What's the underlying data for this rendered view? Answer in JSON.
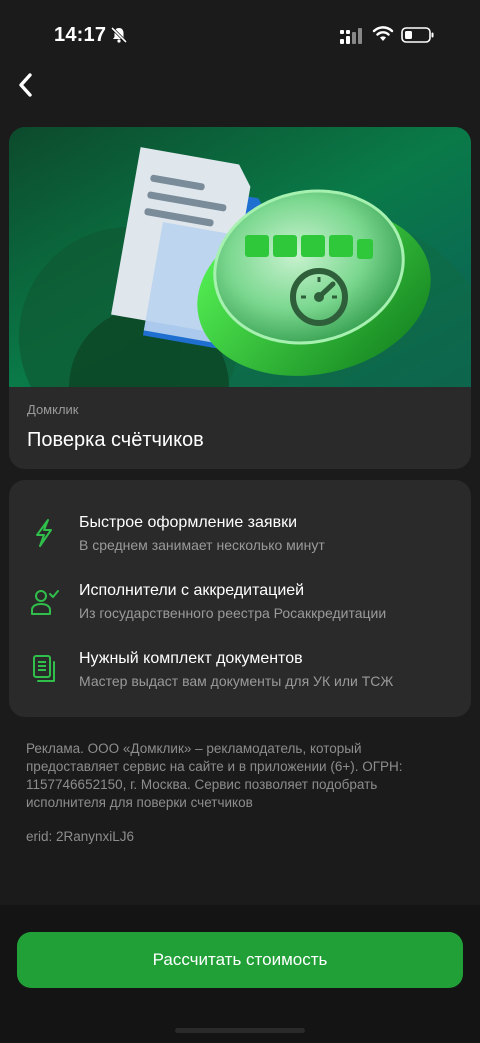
{
  "status": {
    "time": "14:17"
  },
  "hero": {
    "brand": "Домклик",
    "title": "Поверка счётчиков"
  },
  "features": [
    {
      "icon": "lightning-icon",
      "title": "Быстрое оформление заявки",
      "subtitle": "В среднем занимает несколько минут"
    },
    {
      "icon": "user-check-icon",
      "title": "Исполнители с аккредитацией",
      "subtitle": "Из государственного реестра Росаккредитации"
    },
    {
      "icon": "documents-icon",
      "title": "Нужный комплект документов",
      "subtitle": "Мастер выдаст вам документы для УК или ТСЖ"
    }
  ],
  "disclaimer": "Реклама. ООО «Домклик» – рекламодатель, который предоставляет сервис на сайте и в приложении (6+). ОГРН: 1157746652150, г. Москва. Сервис позволяет подобрать исполнителя для поверки счетчиков",
  "erid": "erid: 2RanynxiLJ6",
  "cta": {
    "label": "Рассчитать стоимость"
  },
  "colors": {
    "accent": "#21a038",
    "icon_green": "#2fbf4a",
    "card": "#2a2a2a",
    "background": "#1b1b1b"
  }
}
